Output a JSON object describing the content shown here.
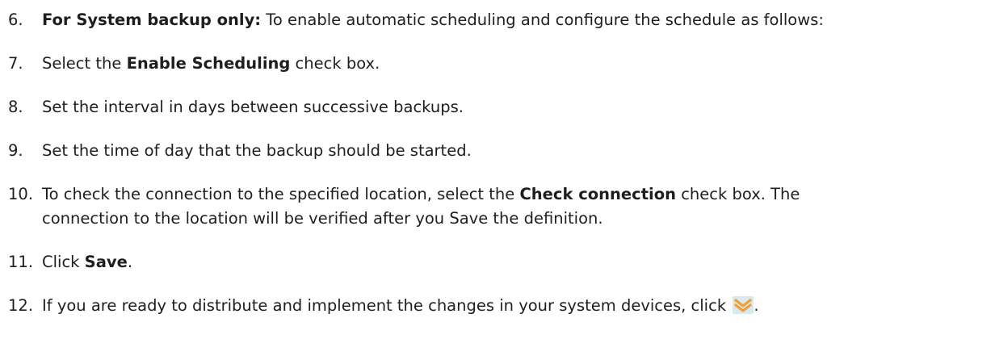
{
  "steps": [
    {
      "num": "6.",
      "parts": [
        "For System backup only:",
        " To enable automatic scheduling and configure the schedule as follows:"
      ]
    },
    {
      "num": "7.",
      "parts": [
        "Select the ",
        "Enable Scheduling",
        " check box."
      ]
    },
    {
      "num": "8.",
      "parts": [
        "Set the interval in days between successive backups."
      ]
    },
    {
      "num": "9.",
      "parts": [
        "Set the time of day that the backup should be started."
      ]
    },
    {
      "num": "10.",
      "parts": [
        "To check the connection to the specified location, select the ",
        "Check connection",
        " check box. The",
        "connection to the location will be verified after you Save the definition."
      ]
    },
    {
      "num": "11.",
      "parts": [
        "Click ",
        "Save",
        "."
      ]
    },
    {
      "num": "12.",
      "parts": [
        "If you are ready to distribute and implement the changes in your system devices, click ",
        "."
      ]
    }
  ],
  "icons": {
    "deploy": "deploy-changes-icon",
    "deploy_color": "#f0a030",
    "deploy_bg": "#d8e8f0"
  }
}
